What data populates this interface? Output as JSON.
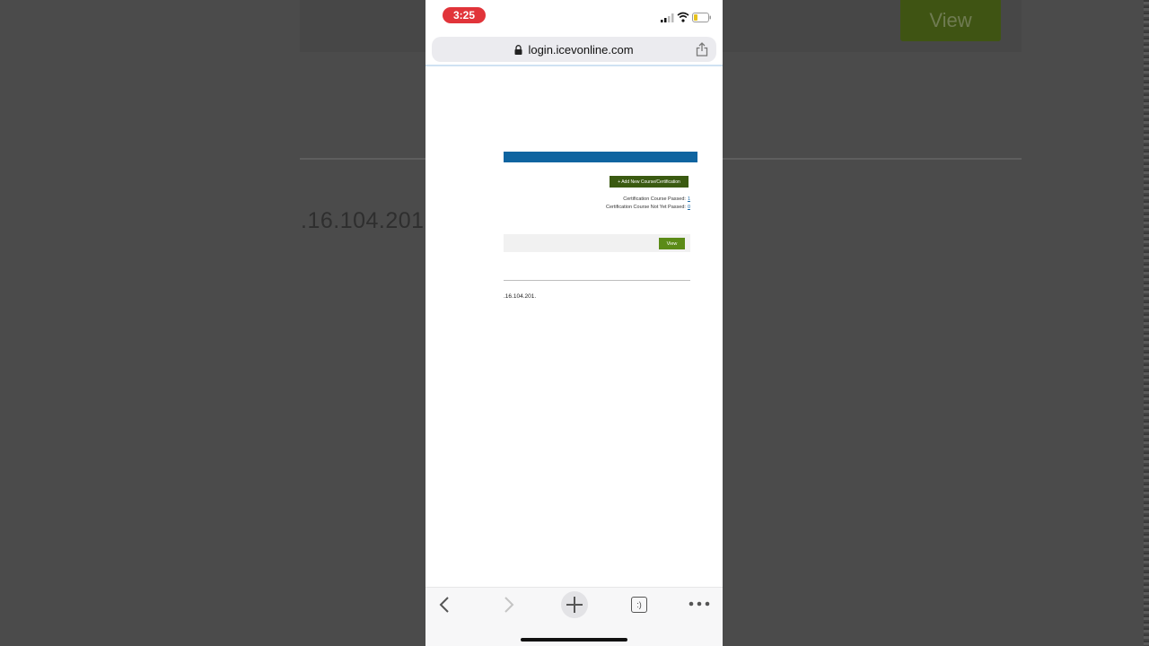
{
  "background": {
    "view_button_label": "View",
    "ip_text": ".16.104.201"
  },
  "status_bar": {
    "time": "3:25"
  },
  "browser": {
    "url": "login.icevonline.com"
  },
  "page": {
    "add_button_label": "+ Add New Course/Certification",
    "cert_passed_label": "Certification Course Passed:",
    "cert_passed_count": "1",
    "cert_not_passed_label": "Certification Course Not Yet Passed:",
    "cert_not_passed_count": "0",
    "view_button_label": "View",
    "ip_text": ".16.104.201."
  },
  "toolbar": {
    "tabs_glyph": ":)"
  },
  "colors": {
    "header_blue": "#0f64a0",
    "add_button_green": "#3a5a11",
    "view_button_green": "#5b8b17",
    "time_pill_red": "#e1343a"
  }
}
